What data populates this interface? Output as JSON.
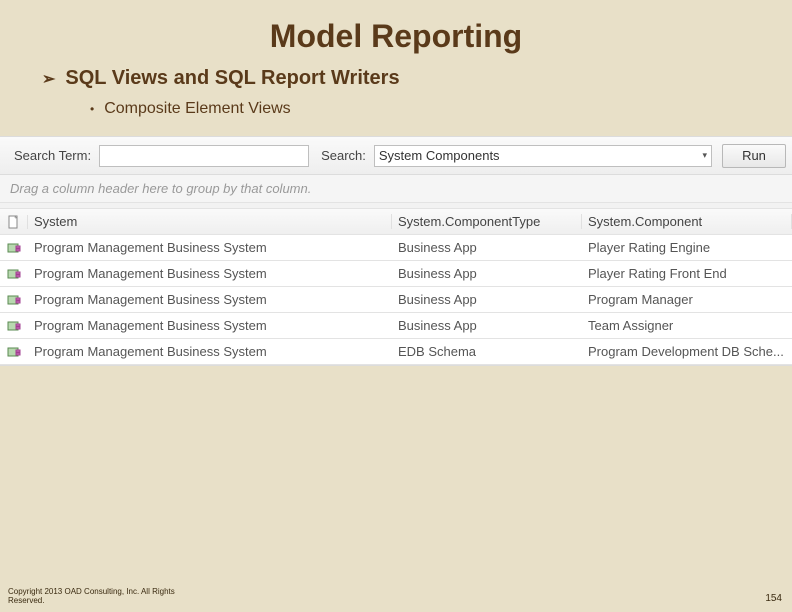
{
  "slide": {
    "title": "Model Reporting",
    "bullet1": "SQL Views and SQL Report Writers",
    "bullet2": "Composite Element Views"
  },
  "search": {
    "term_label": "Search Term:",
    "term_value": "",
    "search_label": "Search:",
    "dropdown_selected": "System Components",
    "run_label": "Run"
  },
  "grid": {
    "group_hint": "Drag a column header here to group by that column.",
    "headers": {
      "system": "System",
      "type": "System.ComponentType",
      "component": "System.Component"
    },
    "rows": [
      {
        "system": "Program Management Business System",
        "type": "Business App",
        "component": "Player Rating Engine"
      },
      {
        "system": "Program Management Business System",
        "type": "Business App",
        "component": "Player Rating Front End"
      },
      {
        "system": "Program Management Business System",
        "type": "Business App",
        "component": "Program Manager"
      },
      {
        "system": "Program Management Business System",
        "type": "Business App",
        "component": "Team Assigner"
      },
      {
        "system": "Program Management Business System",
        "type": "EDB Schema",
        "component": "Program Development DB Sche..."
      }
    ]
  },
  "footer": {
    "copyright_l1": "Copyright 2013 OAD Consulting, Inc.  All Rights",
    "copyright_l2": "Reserved.",
    "page": "154"
  }
}
